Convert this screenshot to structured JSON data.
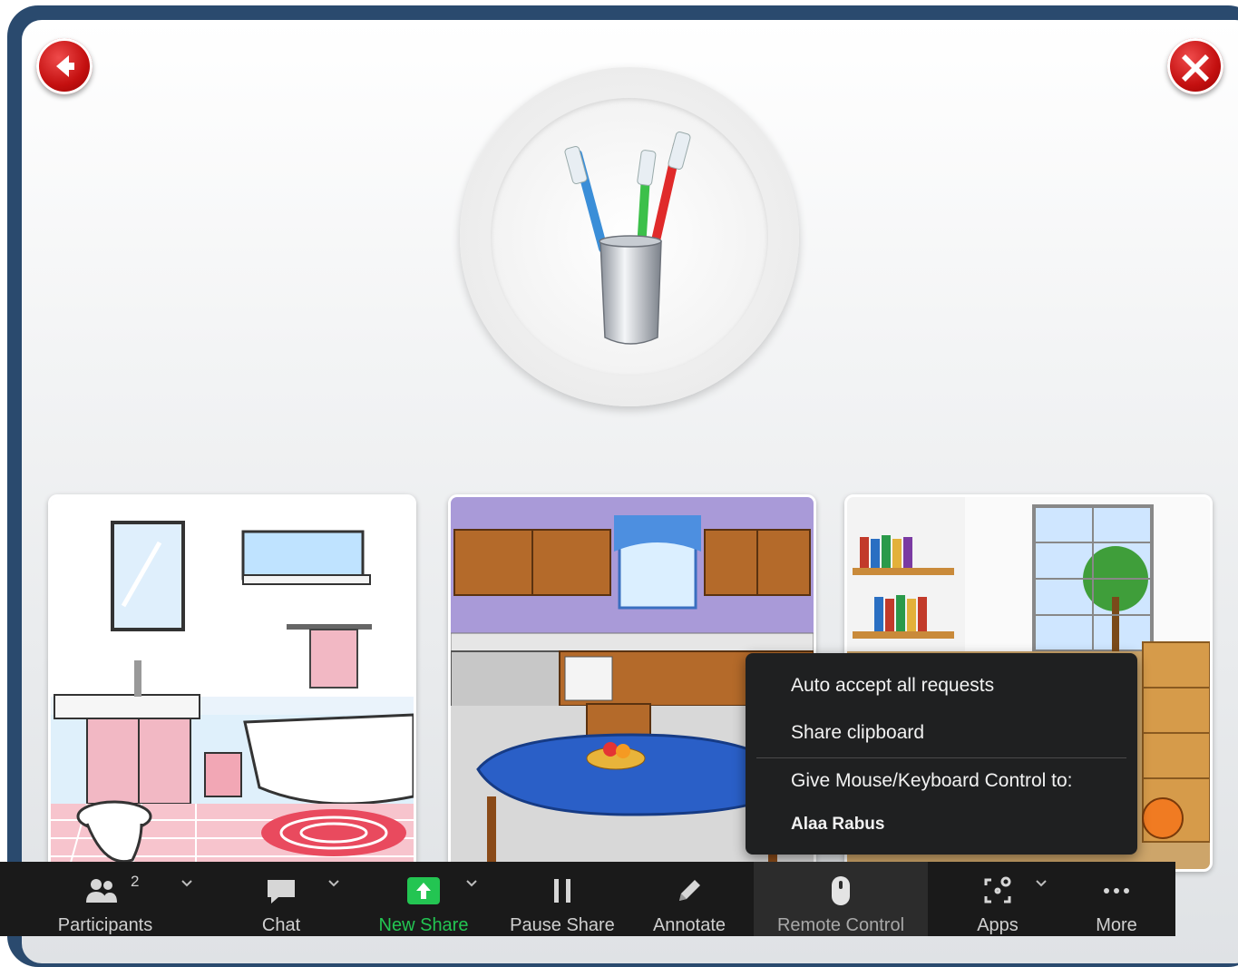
{
  "nav": {
    "back_icon": "back-arrow-icon",
    "close_icon": "close-x-icon"
  },
  "prompt": {
    "image": "toothbrushes-in-cup"
  },
  "choices": [
    {
      "scene": "bathroom"
    },
    {
      "scene": "kitchen"
    },
    {
      "scene": "living-room"
    }
  ],
  "context_menu": {
    "items": [
      "Auto accept all requests",
      "Share clipboard"
    ],
    "section_title": "Give Mouse/Keyboard Control to:",
    "user": "Alaa Rabus"
  },
  "toolbar": {
    "participants_label": "Participants",
    "participants_count": "2",
    "chat_label": "Chat",
    "new_share_label": "New Share",
    "pause_share_label": "Pause Share",
    "annotate_label": "Annotate",
    "remote_control_label": "Remote Control",
    "apps_label": "Apps",
    "more_label": "More",
    "colors": {
      "new_share": "#23c552",
      "bar": "#1a1a1a",
      "text": "#cfcfcf"
    }
  }
}
